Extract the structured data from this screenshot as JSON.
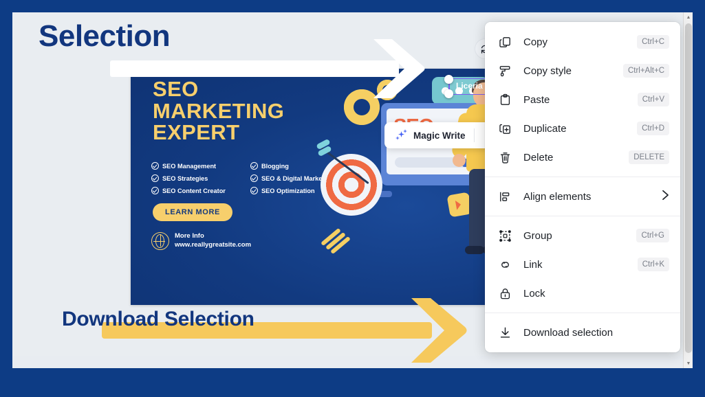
{
  "annotations": {
    "top_label": "Selection",
    "bottom_label": "Download Selection",
    "arrow_top_color": "#ffffff",
    "arrow_bottom_color": "#f6c95c",
    "label_color": "#12367e"
  },
  "editor": {
    "refresh_icon": "refresh-icon",
    "bottom_tab_icon": "chevron-up-icon",
    "scrollbar": {
      "up_arrow_icon": "scroll-up-arrow-icon",
      "down_arrow_icon": "scroll-down-arrow-icon"
    },
    "selection": {
      "text": "Liceria",
      "handle_icon": "selection-handle"
    },
    "toolbar": {
      "magic_write_label": "Magic Write",
      "magic_write_icon": "sparkle-icon"
    }
  },
  "poster": {
    "title_lines": [
      "SEO",
      "MARKETING",
      "EXPERT"
    ],
    "features": [
      "SEO Management",
      "Blogging",
      "SEO Strategies",
      "SEO & Digital Marketing",
      "SEO Content Creator",
      "SEO Optimization"
    ],
    "cta_label": "LEARN MORE",
    "info_label": "More Info",
    "info_url": "www.reallygreatsite.com",
    "illustration_word": "SEO",
    "accent_color": "#f7cf6c",
    "background_color": "#123a80"
  },
  "context_menu": {
    "groups": [
      {
        "items": [
          {
            "icon": "copy-icon",
            "label": "Copy",
            "shortcut": "Ctrl+C"
          },
          {
            "icon": "paint-roller-icon",
            "label": "Copy style",
            "shortcut": "Ctrl+Alt+C"
          },
          {
            "icon": "clipboard-icon",
            "label": "Paste",
            "shortcut": "Ctrl+V"
          },
          {
            "icon": "duplicate-icon",
            "label": "Duplicate",
            "shortcut": "Ctrl+D"
          },
          {
            "icon": "trash-icon",
            "label": "Delete",
            "shortcut": "DELETE"
          }
        ]
      },
      {
        "items": [
          {
            "icon": "align-icon",
            "label": "Align elements",
            "shortcut": "",
            "submenu_icon": "chevron-right-icon"
          }
        ]
      },
      {
        "items": [
          {
            "icon": "group-icon",
            "label": "Group",
            "shortcut": "Ctrl+G"
          },
          {
            "icon": "link-icon",
            "label": "Link",
            "shortcut": "Ctrl+K"
          },
          {
            "icon": "lock-icon",
            "label": "Lock",
            "shortcut": ""
          }
        ]
      },
      {
        "items": [
          {
            "icon": "download-icon",
            "label": "Download selection",
            "shortcut": ""
          }
        ]
      }
    ]
  }
}
